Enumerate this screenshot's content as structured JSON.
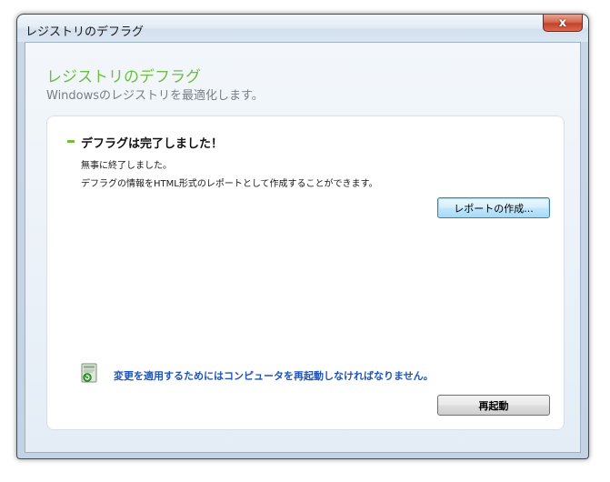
{
  "window": {
    "title": "レジストリのデフラグ",
    "close_label": "x"
  },
  "header": {
    "title": "レジストリのデフラグ",
    "subtitle": "Windowsのレジストリを最適化します。"
  },
  "status": {
    "title": "デフラグは完了しました！",
    "line1": "無事に終了しました。",
    "line2": "デフラグの情報をHTML形式のレポートとして作成することができます。"
  },
  "buttons": {
    "report": "レポートの作成...",
    "restart": "再起動"
  },
  "notice": {
    "text": "変更を適用するためにはコンピュータを再起動しなければなりません。",
    "icon": "restart-computer-icon"
  },
  "colors": {
    "accent_green": "#6cbf3f",
    "notice_blue": "#1f55b8",
    "close_red": "#c4422a"
  }
}
